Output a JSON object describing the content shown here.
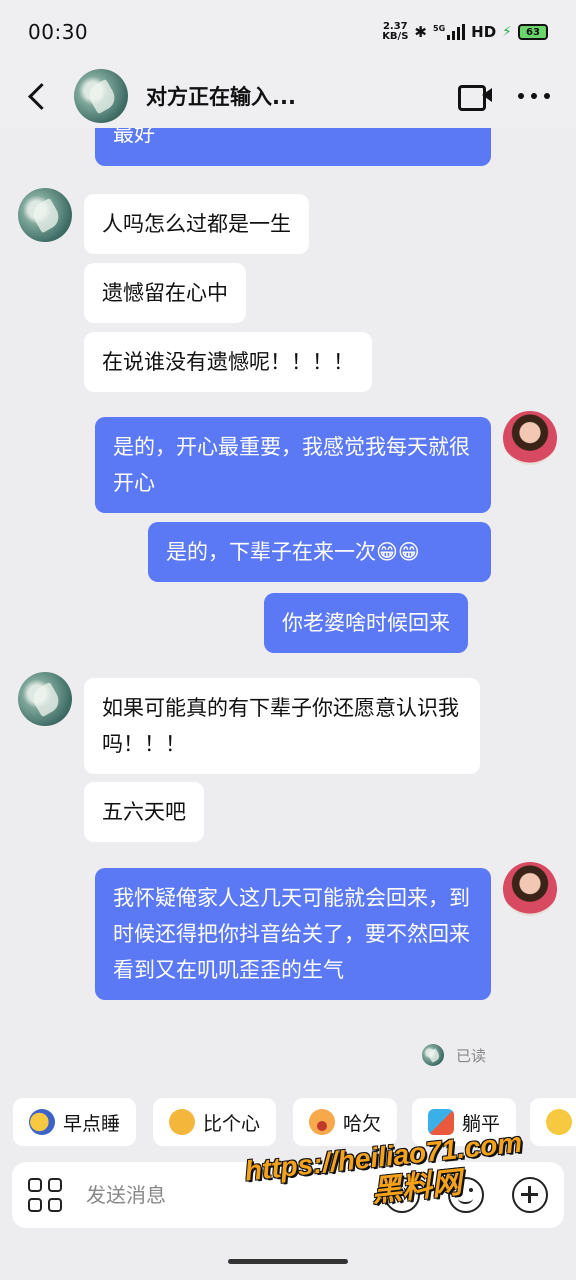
{
  "status_bar": {
    "time": "00:30",
    "net_speed_value": "2.37",
    "net_speed_unit": "KB/S",
    "network": "5G",
    "hd": "HD",
    "battery": "63"
  },
  "header": {
    "title": "对方正在输入...",
    "icons": [
      "back-icon",
      "video-call-icon",
      "more-icon"
    ]
  },
  "messages": [
    {
      "side": "out",
      "text": "最好"
    },
    {
      "side": "in",
      "text": "人吗怎么过都是一生"
    },
    {
      "side": "in",
      "text": "遗憾留在心中"
    },
    {
      "side": "in",
      "text": "在说谁没有遗憾呢！！！！"
    },
    {
      "side": "out",
      "text": "是的，开心最重要，我感觉我每天就很开心"
    },
    {
      "side": "out",
      "text": "是的，下辈子在来一次😁😁"
    },
    {
      "side": "out",
      "text": "你老婆啥时候回来"
    },
    {
      "side": "in",
      "text": "如果可能真的有下辈子你还愿意认识我吗！！！"
    },
    {
      "side": "in",
      "text": "五六天吧"
    },
    {
      "side": "out",
      "text": "我怀疑俺家人这几天可能就会回来，到时候还得把你抖音给关了，要不然回来看到又在叽叽歪歪的生气"
    }
  ],
  "read_status": "已读",
  "quick_replies": [
    {
      "label": "早点睡",
      "icon": "sleep-emoji"
    },
    {
      "label": "比个心",
      "icon": "heart-hands-emoji"
    },
    {
      "label": "哈欠",
      "icon": "yawn-emoji"
    },
    {
      "label": "躺平",
      "icon": "lie-flat-emoji"
    }
  ],
  "input": {
    "placeholder": "发送消息"
  },
  "watermark": {
    "url": "https://heiliao71.com",
    "name": "黑料网"
  },
  "colors": {
    "out_bubble": "#5b78f5",
    "in_bubble": "#ffffff",
    "background": "#ededf0"
  }
}
